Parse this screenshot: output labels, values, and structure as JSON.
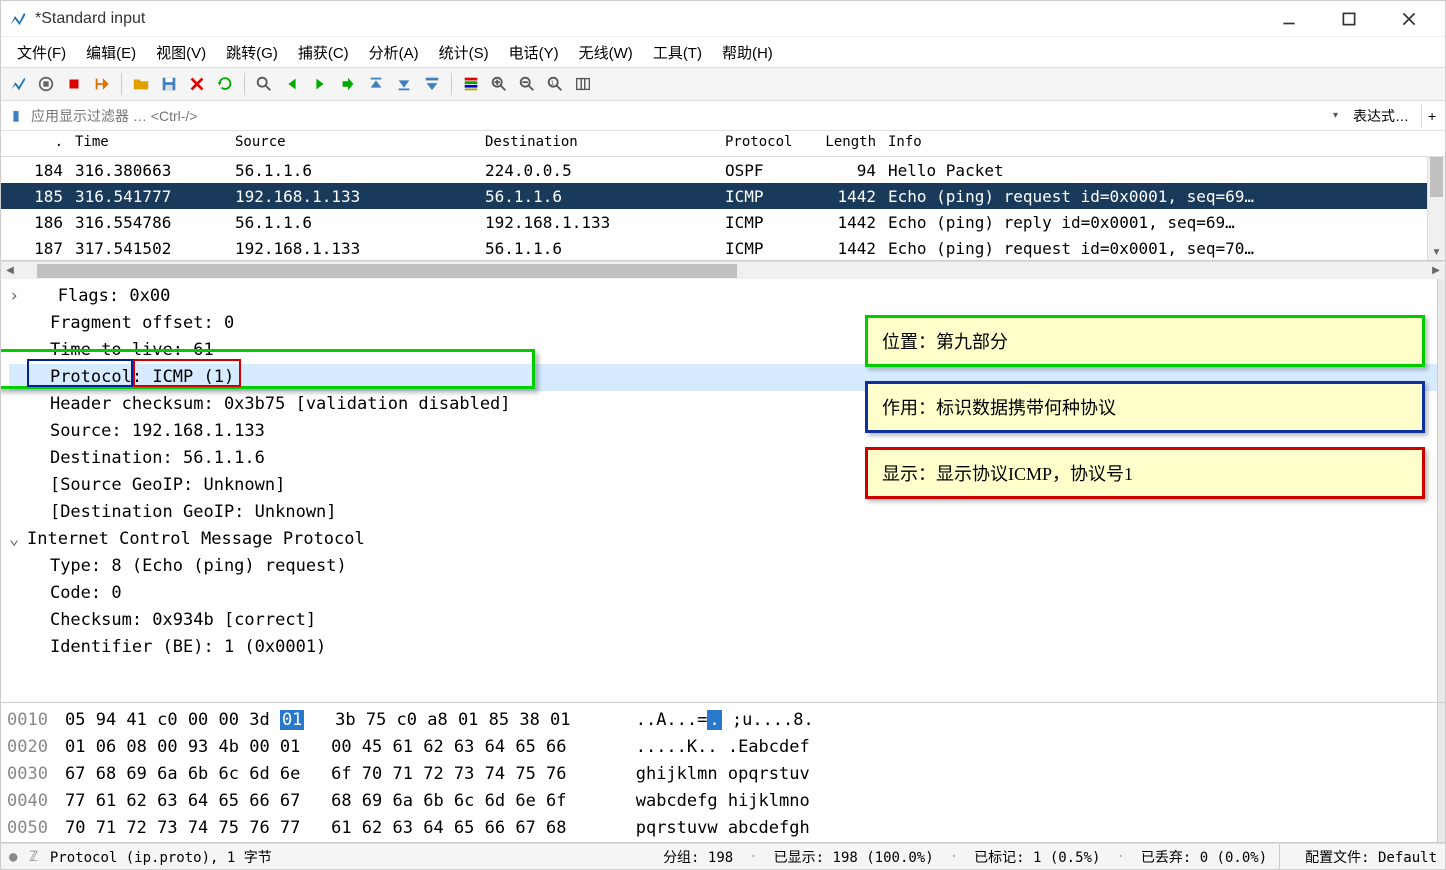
{
  "window": {
    "title": "*Standard input"
  },
  "menu": {
    "file": "文件(F)",
    "edit": "编辑(E)",
    "view": "视图(V)",
    "go": "跳转(G)",
    "capture": "捕获(C)",
    "analyze": "分析(A)",
    "stats": "统计(S)",
    "telephony": "电话(Y)",
    "wireless": "无线(W)",
    "tools": "工具(T)",
    "help": "帮助(H)"
  },
  "filter": {
    "placeholder": "应用显示过滤器 … <Ctrl-/>",
    "expr_btn": "表达式…"
  },
  "columns": {
    "no": ".",
    "time": "Time",
    "src": "Source",
    "dst": "Destination",
    "proto": "Protocol",
    "len": "Length",
    "info": "Info"
  },
  "packets": [
    {
      "no": "184",
      "time": "316.380663",
      "src": "56.1.1.6",
      "dst": "224.0.0.5",
      "proto": "OSPF",
      "len": "94",
      "info": "Hello Packet",
      "sel": false
    },
    {
      "no": "185",
      "time": "316.541777",
      "src": "192.168.1.133",
      "dst": "56.1.1.6",
      "proto": "ICMP",
      "len": "1442",
      "info": "Echo (ping) request  id=0x0001, seq=69…",
      "sel": true
    },
    {
      "no": "186",
      "time": "316.554786",
      "src": "56.1.1.6",
      "dst": "192.168.1.133",
      "proto": "ICMP",
      "len": "1442",
      "info": "Echo (ping) reply    id=0x0001, seq=69…",
      "sel": false
    },
    {
      "no": "187",
      "time": "317.541502",
      "src": "192.168.1.133",
      "dst": "56.1.1.6",
      "proto": "ICMP",
      "len": "1442",
      "info": "Echo (ping) request  id=0x0001, seq=70…",
      "sel": false
    }
  ],
  "details": {
    "flags": "Flags: 0x00",
    "fragoff": "Fragment offset: 0",
    "ttl": "Time to live: 61",
    "proto_label": "Protocol:",
    "proto_val": "ICMP (1)",
    "checksum": "Header checksum: 0x3b75 [validation disabled]",
    "src": "Source: 192.168.1.133",
    "dst": "Destination: 56.1.1.6",
    "geosrc": "[Source GeoIP: Unknown]",
    "geodst": "[Destination GeoIP: Unknown]",
    "icmp_hdr": "Internet Control Message Protocol",
    "icmp_type": "Type: 8 (Echo (ping) request)",
    "icmp_code": "Code: 0",
    "icmp_cksum": "Checksum: 0x934b [correct]",
    "icmp_id": "Identifier (BE): 1 (0x0001)"
  },
  "callouts": {
    "pos": "位置：第九部分",
    "role": "作用：标识数据携带何种协议",
    "disp": "显示：显示协议ICMP，协议号1"
  },
  "hex": [
    {
      "off": "0010",
      "b1": "05 94 41 c0 00 00 3d ",
      "sel": "01",
      "b2": "   3b 75 c0 a8 01 85 38 01",
      "asc": "..A...=",
      "asel": ".",
      "asc2": " ;u....8."
    },
    {
      "off": "0020",
      "b1": "01 06 08 00 93 4b 00 01   00 45 61 62 63 64 65 66",
      "asc": ".....K.. .Eabcdef"
    },
    {
      "off": "0030",
      "b1": "67 68 69 6a 6b 6c 6d 6e   6f 70 71 72 73 74 75 76",
      "asc": "ghijklmn opqrstuv"
    },
    {
      "off": "0040",
      "b1": "77 61 62 63 64 65 66 67   68 69 6a 6b 6c 6d 6e 6f",
      "asc": "wabcdefg hijklmno"
    },
    {
      "off": "0050",
      "b1": "70 71 72 73 74 75 76 77   61 62 63 64 65 66 67 68",
      "asc": "pqrstuvw abcdefgh"
    }
  ],
  "status": {
    "field": "Protocol (ip.proto), 1 字节",
    "packets": "分组: 198",
    "displayed": "已显示: 198 (100.0%)",
    "marked": "已标记: 1 (0.5%)",
    "dropped": "已丢弃: 0 (0.0%)",
    "profile": "配置文件: Default"
  },
  "icons": {
    "fin": "fin",
    "folder": "folder",
    "save": "save",
    "close": "close",
    "reload": "reload",
    "find": "find",
    "back": "back",
    "forward": "forward",
    "jump": "jump",
    "goto-first": "goto-first",
    "goto-last": "goto-last",
    "auto-scroll": "auto-scroll",
    "colorize": "colorize",
    "zoom-in": "zoom-in",
    "zoom-out": "zoom-out",
    "zoom-100": "zoom-100",
    "resize": "resize"
  }
}
